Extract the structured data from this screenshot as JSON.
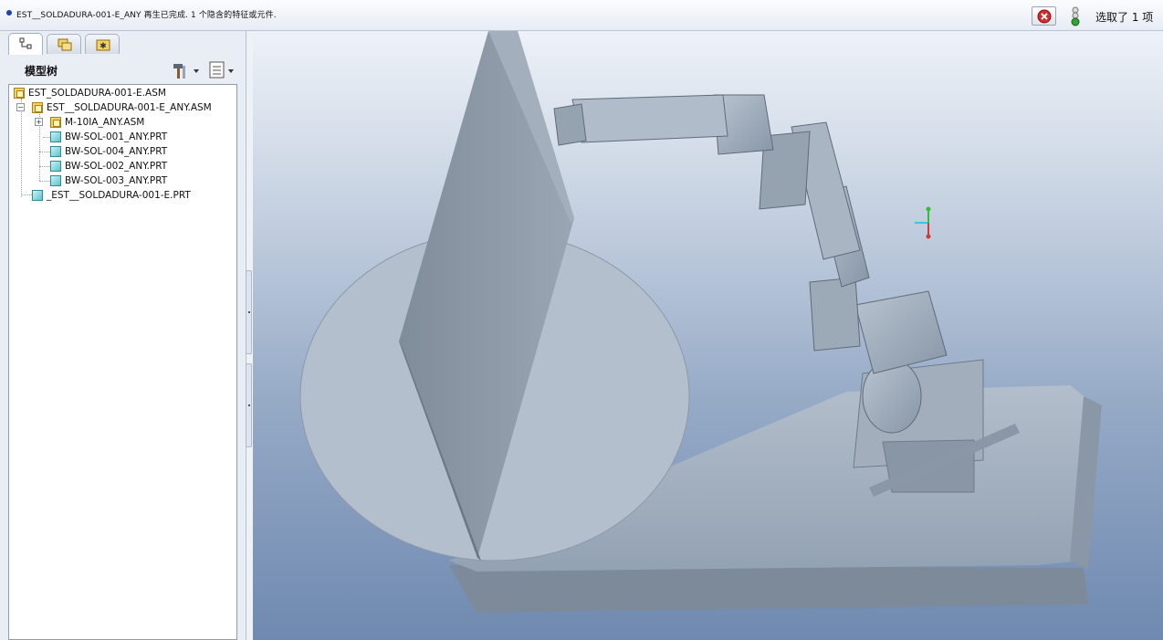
{
  "message_bar": {
    "text": "EST__SOLDADURA-001-E_ANY 再生已完成. 1 个隐含的特征或元件.",
    "selection_status": "选取了 1 项"
  },
  "left_panel": {
    "tabs": [
      {
        "name": "model-tree-tab",
        "icon": "model-tree-icon",
        "active": true
      },
      {
        "name": "folder-browser-tab",
        "icon": "folders-icon",
        "active": false
      },
      {
        "name": "favorites-tab",
        "icon": "favorites-icon",
        "active": false
      }
    ],
    "tree_title": "模型树",
    "settings_icon": "hammer-settings-icon",
    "show_icon": "show-list-icon",
    "tree_items": [
      {
        "label": "EST_SOLDADURA-001-E.ASM",
        "type": "asm"
      },
      {
        "label": "EST__SOLDADURA-001-E_ANY.ASM",
        "type": "asm"
      },
      {
        "label": "M-10IA_ANY.ASM",
        "type": "asm"
      },
      {
        "label": "BW-SOL-001_ANY.PRT",
        "type": "prt"
      },
      {
        "label": "BW-SOL-004_ANY.PRT",
        "type": "prt"
      },
      {
        "label": "BW-SOL-002_ANY.PRT",
        "type": "prt"
      },
      {
        "label": "BW-SOL-003_ANY.PRT",
        "type": "prt"
      },
      {
        "label": "_EST__SOLDADURA-001-E.PRT",
        "type": "prt"
      }
    ]
  },
  "colors": {
    "model_surface": "#a9b6c4",
    "model_dark": "#7d8a99",
    "viewport_top": "#eef2f8",
    "viewport_bottom": "#6f89b0"
  }
}
